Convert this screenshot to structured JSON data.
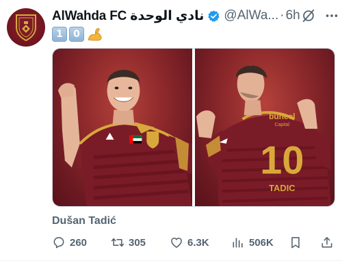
{
  "tweet": {
    "display_name": "AlWahda FC نادي الوحدة",
    "handle": "@AlWa...",
    "separator": "·",
    "time": "6h",
    "text_emojis": [
      "1",
      "0"
    ],
    "caption": "Dušan Tadić"
  },
  "photos": {
    "right_jersey_sponsor": "buneel",
    "right_jersey_sponsor_sub": "Capital",
    "right_jersey_number": "10",
    "right_jersey_name": "TADIC"
  },
  "actions": {
    "replies": "260",
    "reposts": "305",
    "likes": "6.3K",
    "views": "506K"
  },
  "colors": {
    "text_secondary": "#536471",
    "verified_blue": "#1d9bf0",
    "jersey_maroon": "#7a1b28",
    "gold": "#d8a93a"
  },
  "icons": [
    "avatar-crest",
    "verified-badge-icon",
    "grok-icon",
    "more-icon",
    "reply-icon",
    "repost-icon",
    "like-icon",
    "views-icon",
    "bookmark-icon",
    "share-icon"
  ]
}
